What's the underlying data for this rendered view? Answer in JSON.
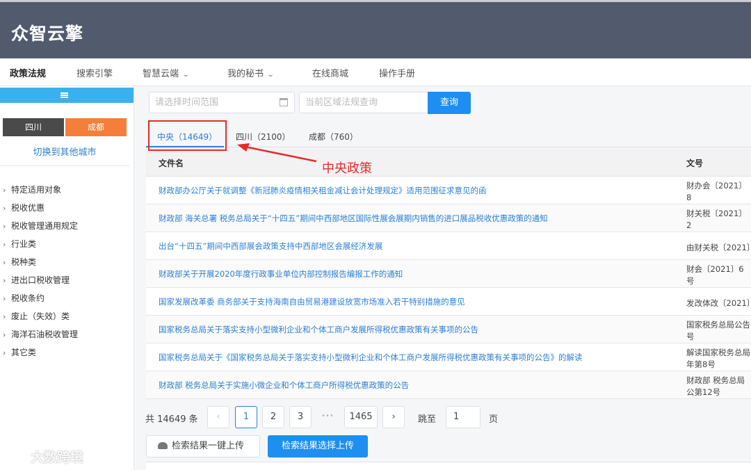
{
  "header": {
    "logo": "众智云擎"
  },
  "nav": {
    "items": [
      {
        "label": "政策法规",
        "active": true
      },
      {
        "label": "搜索引擎"
      },
      {
        "label": "智慧云端",
        "dropdown": true
      },
      {
        "label": "我的秘书",
        "dropdown": true
      },
      {
        "label": "在线商城"
      },
      {
        "label": "操作手册"
      }
    ]
  },
  "sidebar": {
    "province": "四川",
    "city": "成都",
    "switch_label": "切换到其他城市",
    "categories": [
      "特定适用对象",
      "税收优惠",
      "税收管理通用规定",
      "行业类",
      "税种类",
      "进出口税收管理",
      "税收条约",
      "废止（失效）类",
      "海洋石油税收管理",
      "其它类"
    ]
  },
  "search": {
    "date_placeholder": "请选择时间范围",
    "keyword_placeholder": "当前区域法规查询",
    "query_label": "查询"
  },
  "tabs": [
    {
      "label": "中央（14649）",
      "active": true
    },
    {
      "label": "四川（2100）"
    },
    {
      "label": "成都（760）"
    }
  ],
  "annotation": {
    "text": "中央政策",
    "color": "#e62a2a"
  },
  "table": {
    "headers": {
      "name": "文件名",
      "docno": "文号"
    },
    "rows": [
      {
        "title": "财政部办公厅关于就调整《新冠肺炎疫情相关租金减让会计处理规定》适用范围征求意见的函",
        "docno": "财办会〔2021〕8"
      },
      {
        "title": "财政部 海关总署 税务总局关于“十四五”期间中西部地区国际性展会展期内销售的进口展品税收优惠政策的通知",
        "docno": "财关税〔2021〕2"
      },
      {
        "title": "出台“十四五”期间中西部展会政策支持中西部地区会展经济发展",
        "docno": "由财关税〔2021〕"
      },
      {
        "title": "财政部关于开展2020年度行政事业单位内部控制报告编报工作的通知",
        "docno": "财会〔2021〕6号"
      },
      {
        "title": "国家发展改革委 商务部关于支持海南自由贸易港建设放宽市场准入若干特别措施的意见",
        "docno": "发改体改〔2021〕"
      },
      {
        "title": "国家税务总局关于落实支持小型微利企业和个体工商户发展所得税优惠政策有关事项的公告",
        "docno": "国家税务总局公告号"
      },
      {
        "title": "国家税务总局关于《国家税务总局关于落实支持小型微利企业和个体工商户发展所得税优惠政策有关事项的公告》的解读",
        "docno": "解读国家税务总局年第8号"
      },
      {
        "title": "财政部 税务总局关于实施小微企业和个体工商户所得税优惠政策的公告",
        "docno": "财政部 税务总局公第12号"
      }
    ]
  },
  "pagination": {
    "total_label": "共 14649 条",
    "prev": "‹",
    "pages": [
      "1",
      "2",
      "3"
    ],
    "ellipsis": "•••",
    "last_page": "1465",
    "next": "›",
    "jump_label": "跳至",
    "jump_value": "1",
    "page_suffix": "页"
  },
  "actions": {
    "upload_all": "检索结果一键上传",
    "upload_selected": "检索结果选择上传"
  },
  "watermark": "大数跨境",
  "colors": {
    "header_bg": "#525a6e",
    "accent_blue": "#1e8ff0",
    "city_orange": "#f47f3a",
    "annotation_red": "#e62a2a"
  }
}
